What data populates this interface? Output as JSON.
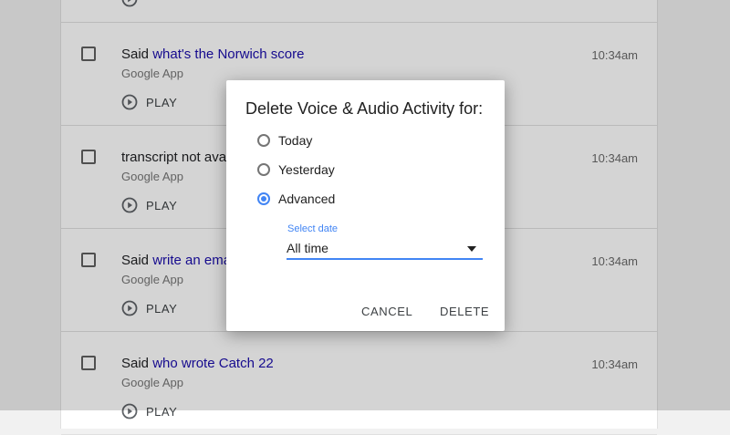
{
  "activity": {
    "items": [
      {
        "prefix": "",
        "link": "",
        "source": "",
        "time": "",
        "play": ""
      },
      {
        "prefix": "Said ",
        "link": "what's the Norwich score",
        "source": "Google App",
        "time": "10:34am",
        "play": "PLAY"
      },
      {
        "prefix": "transcript not avail",
        "link": "",
        "source": "Google App",
        "time": "10:34am",
        "play": "PLAY"
      },
      {
        "prefix": "Said ",
        "link": "write an ema",
        "source": "Google App",
        "time": "10:34am",
        "play": "PLAY"
      },
      {
        "prefix": "Said ",
        "link": "who wrote Catch 22",
        "source": "Google App",
        "time": "10:34am",
        "play": "PLAY"
      }
    ]
  },
  "dialog": {
    "title": "Delete Voice & Audio Activity for:",
    "options": [
      {
        "label": "Today",
        "selected": false
      },
      {
        "label": "Yesterday",
        "selected": false
      },
      {
        "label": "Advanced",
        "selected": true
      }
    ],
    "select_label": "Select date",
    "select_value": "All time",
    "cancel_label": "CANCEL",
    "delete_label": "DELETE"
  },
  "colors": {
    "accent": "#4285f4",
    "link": "#1a0dab",
    "scrim": "rgba(0,0,0,0.17)"
  }
}
